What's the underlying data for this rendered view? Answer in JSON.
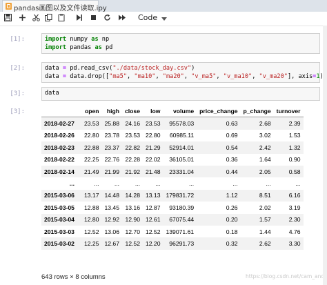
{
  "tab": {
    "title": "pandas画图以及文件读取.ipy"
  },
  "toolbar": {
    "celltype": "Code",
    "icons": [
      "save-icon",
      "add-cell-icon",
      "cut-icon",
      "copy-icon",
      "paste-icon",
      "run-icon",
      "stop-icon",
      "restart-icon",
      "fast-forward-icon",
      "chevron-down-icon"
    ]
  },
  "cells": [
    {
      "prompt": "[1]:"
    },
    {
      "prompt": "[2]:"
    },
    {
      "prompt": "[3]:",
      "code": "data"
    }
  ],
  "output": {
    "prompt": "[3]:",
    "columns": [
      "open",
      "high",
      "close",
      "low",
      "volume",
      "price_change",
      "p_change",
      "turnover"
    ],
    "rows": [
      {
        "index": "2018-02-27",
        "values": [
          "23.53",
          "25.88",
          "24.16",
          "23.53",
          "95578.03",
          "0.63",
          "2.68",
          "2.39"
        ]
      },
      {
        "index": "2018-02-26",
        "values": [
          "22.80",
          "23.78",
          "23.53",
          "22.80",
          "60985.11",
          "0.69",
          "3.02",
          "1.53"
        ]
      },
      {
        "index": "2018-02-23",
        "values": [
          "22.88",
          "23.37",
          "22.82",
          "21.29",
          "52914.01",
          "0.54",
          "2.42",
          "1.32"
        ]
      },
      {
        "index": "2018-02-22",
        "values": [
          "22.25",
          "22.76",
          "22.28",
          "22.02",
          "36105.01",
          "0.36",
          "1.64",
          "0.90"
        ]
      },
      {
        "index": "2018-02-14",
        "values": [
          "21.49",
          "21.99",
          "21.92",
          "21.48",
          "23331.04",
          "0.44",
          "2.05",
          "0.58"
        ]
      },
      {
        "index": "...",
        "values": [
          "...",
          "...",
          "...",
          "...",
          "...",
          "...",
          "...",
          "..."
        ]
      },
      {
        "index": "2015-03-06",
        "values": [
          "13.17",
          "14.48",
          "14.28",
          "13.13",
          "179831.72",
          "1.12",
          "8.51",
          "6.16"
        ]
      },
      {
        "index": "2015-03-05",
        "values": [
          "12.88",
          "13.45",
          "13.16",
          "12.87",
          "93180.39",
          "0.26",
          "2.02",
          "3.19"
        ]
      },
      {
        "index": "2015-03-04",
        "values": [
          "12.80",
          "12.92",
          "12.90",
          "12.61",
          "67075.44",
          "0.20",
          "1.57",
          "2.30"
        ]
      },
      {
        "index": "2015-03-03",
        "values": [
          "12.52",
          "13.06",
          "12.70",
          "12.52",
          "139071.61",
          "0.18",
          "1.44",
          "4.76"
        ]
      },
      {
        "index": "2015-03-02",
        "values": [
          "12.25",
          "12.67",
          "12.52",
          "12.20",
          "96291.73",
          "0.32",
          "2.62",
          "3.30"
        ]
      }
    ],
    "summary": "643 rows × 8 columns"
  },
  "watermark": "https://blog.csdn.net/cam_and"
}
